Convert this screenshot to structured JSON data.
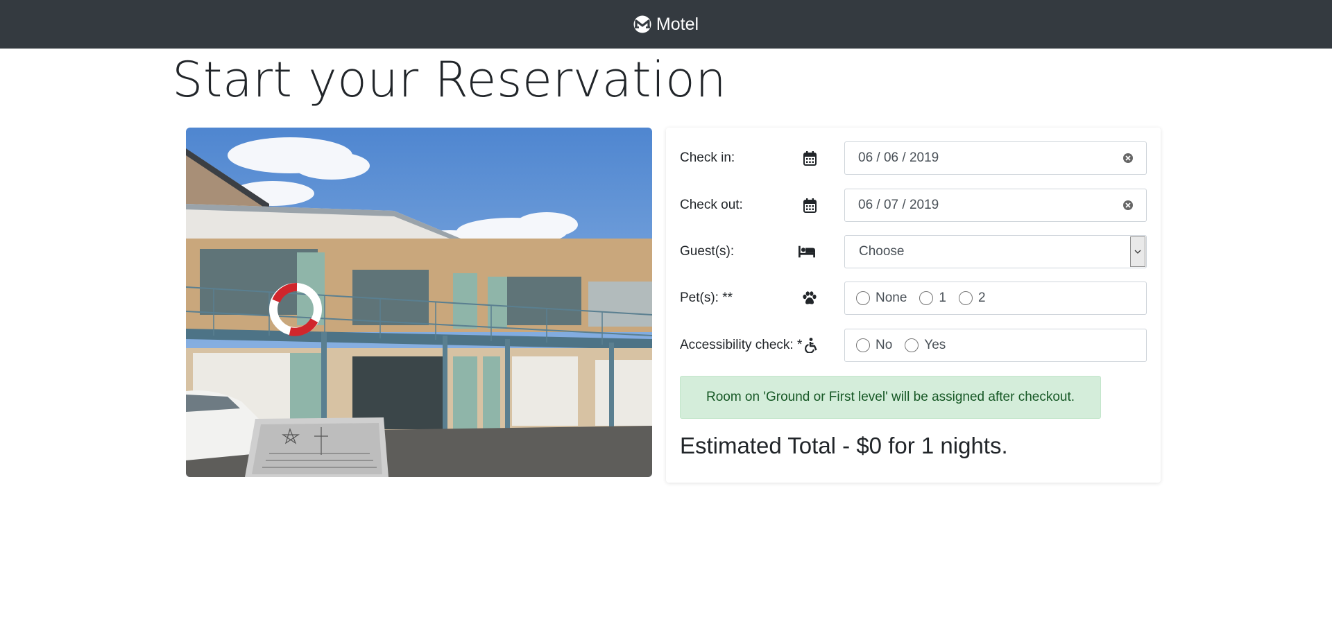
{
  "navbar": {
    "brand": "Motel",
    "logo_icon": "monero-m-logo-icon",
    "background": "#343a40"
  },
  "page": {
    "title": "Start your Reservation"
  },
  "photo": {
    "description_icon": "motel-building-photo"
  },
  "form": {
    "check_in": {
      "label": "Check in:",
      "icon": "calendar-icon",
      "value": "06 / 06 / 2019"
    },
    "check_out": {
      "label": "Check out:",
      "icon": "calendar-icon",
      "value": "06 / 07 / 2019"
    },
    "guests": {
      "label": "Guest(s):",
      "icon": "bed-icon",
      "selected": "Choose"
    },
    "pets": {
      "label": "Pet(s): **",
      "icon": "paw-icon",
      "options": [
        "None",
        "1",
        "2"
      ]
    },
    "accessibility": {
      "label": "Accessibility check: *",
      "icon": "wheelchair-icon",
      "options": [
        "No",
        "Yes"
      ]
    },
    "alert": "Room on 'Ground or First level' will be assigned after checkout.",
    "total": "Estimated Total - $0 for 1 nights."
  },
  "colors": {
    "alert_bg": "#d4edda",
    "alert_text": "#155724",
    "navbar": "#343a40"
  }
}
